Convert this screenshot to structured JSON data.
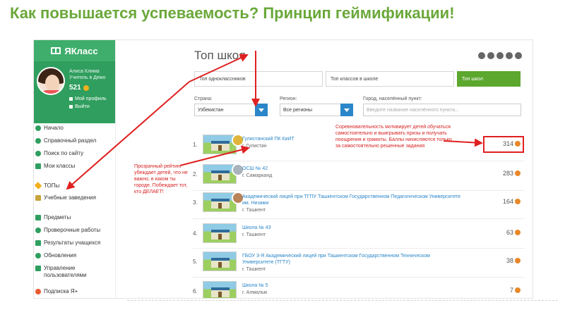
{
  "slide_title": "Как повышается успеваемость? Принцип геймификации!",
  "sidebar": {
    "brand": "ЯКласс",
    "user_name": "Алиса Клима",
    "user_role": "Учитель в Демо",
    "points": "521",
    "links": [
      "Мой профиль",
      "Выйти"
    ],
    "items": [
      {
        "label": "Начало",
        "icon": "home-icon"
      },
      {
        "label": "Справочный раздел",
        "icon": "help-icon"
      },
      {
        "label": "Поиск по сайту",
        "icon": "search-icon"
      },
      {
        "label": "Мои классы",
        "icon": "users-icon"
      },
      {
        "label": "ТОПы",
        "icon": "star-icon"
      },
      {
        "label": "Учебные заведения",
        "icon": "building-icon"
      },
      {
        "label": "Предметы",
        "icon": "book-icon"
      },
      {
        "label": "Проверочные работы",
        "icon": "check-icon"
      },
      {
        "label": "Результаты учащихся",
        "icon": "results-icon"
      },
      {
        "label": "Обновления",
        "icon": "refresh-icon"
      },
      {
        "label": "Управление пользователями",
        "icon": "manage-icon"
      },
      {
        "label": "Подписка Я+",
        "icon": "subscription-icon"
      }
    ]
  },
  "main": {
    "title": "Топ школ",
    "tabs": [
      "Топ одноклассников",
      "Топ классов в школе",
      "Топ школ"
    ],
    "filters": {
      "country_label": "Страна:",
      "country_value": "Узбекистан",
      "region_label": "Регион:",
      "region_value": "Все регионы",
      "city_label": "Город, населённый пункт:",
      "city_placeholder": "Введите название населённого пункта..."
    },
    "rows": [
      {
        "rank": "1.",
        "name": "Гулистанский ПК КиИТ",
        "city": "г. Гулистан",
        "score": "314",
        "medal": "#e0b43a"
      },
      {
        "rank": "2.",
        "name": "ОСШ № 42",
        "city": "г. Самарканд",
        "score": "283",
        "medal": "#a9b3bb"
      },
      {
        "rank": "3.",
        "name": "Академический лицей при ТГПУ Ташкентском Государственном Педагогическом Университете им. Низами",
        "city": "г. Ташкент",
        "score": "164",
        "medal": "#b9835a"
      },
      {
        "rank": "4.",
        "name": "Школа № 43",
        "city": "г. Ташкент",
        "score": "63"
      },
      {
        "rank": "5.",
        "name": "ГБОУ 3-Я Академический лицей при Ташкентском Государственном Техническом Университете (ТГТУ)",
        "city": "г. Ташкент",
        "score": "38"
      },
      {
        "rank": "6.",
        "name": "Школа № 5",
        "city": "г. Алмалык",
        "score": "7"
      }
    ]
  },
  "annotations": {
    "left": "Прозрачный рейтинг убеждает детей, что не важно, в каком ты городе. Побеждает тот, кто ДЕЛАЕТ!",
    "right": "Соревновательность мотивирует детей обучаться самостоятельно и выигрывать призы и получать поощрения и грамоты. Баллы начисляются только за самостоятельно решенные задания"
  },
  "colors": {
    "title": "#6aa83a",
    "brand": "#3fae6c",
    "accent": "#5ca82e",
    "annotation": "#d62020"
  }
}
